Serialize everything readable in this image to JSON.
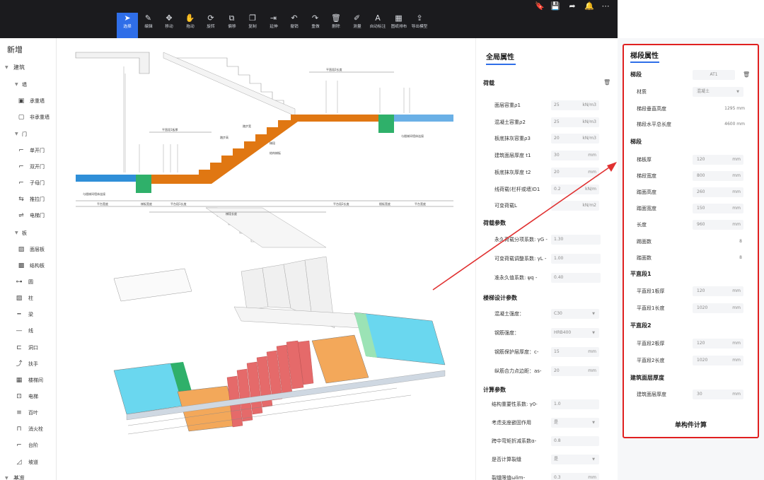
{
  "toolbar": {
    "tools": [
      {
        "label": "选择",
        "icon": "cursor-icon"
      },
      {
        "label": "编辑",
        "icon": "pencil-icon"
      },
      {
        "label": "移动",
        "icon": "move-icon"
      },
      {
        "label": "拖动",
        "icon": "hand-icon"
      },
      {
        "label": "旋转",
        "icon": "rotate-icon"
      },
      {
        "label": "偏移",
        "icon": "offset-icon"
      },
      {
        "label": "复制",
        "icon": "copy-icon"
      },
      {
        "label": "延伸",
        "icon": "extend-icon"
      },
      {
        "label": "撤销",
        "icon": "undo-icon"
      },
      {
        "label": "重做",
        "icon": "redo-icon"
      },
      {
        "label": "删除",
        "icon": "trash-icon"
      },
      {
        "label": "测量",
        "icon": "measure-icon"
      },
      {
        "label": "自动标注",
        "icon": "auto-label-icon"
      },
      {
        "label": "图纸排布",
        "icon": "layout-icon"
      },
      {
        "label": "导出模型",
        "icon": "export-icon"
      }
    ],
    "top_icons": [
      "bookmark-icon",
      "save-icon",
      "share-icon",
      "alert-icon",
      "more-icon"
    ]
  },
  "sidebar": {
    "title": "新增",
    "categories": [
      {
        "label": "建筑"
      },
      {
        "label": "墙"
      },
      {
        "label": "门"
      },
      {
        "label": "板"
      },
      {
        "label": "基准"
      }
    ],
    "items": [
      {
        "label": "承重墙"
      },
      {
        "label": "非承重墙"
      },
      {
        "label": "单开门"
      },
      {
        "label": "双开门"
      },
      {
        "label": "子母门"
      },
      {
        "label": "推拉门"
      },
      {
        "label": "电梯门"
      },
      {
        "label": "面层板"
      },
      {
        "label": "结构板"
      },
      {
        "label": "圆"
      },
      {
        "label": "柱"
      },
      {
        "label": "梁"
      },
      {
        "label": "线"
      },
      {
        "label": "洞口"
      },
      {
        "label": "扶手"
      },
      {
        "label": "楼梯间"
      },
      {
        "label": "电梯"
      },
      {
        "label": "百叶"
      },
      {
        "label": "消火栓"
      },
      {
        "label": "台阶"
      },
      {
        "label": "坡道"
      }
    ]
  },
  "global_panel": {
    "title": "全局属性",
    "sections": {
      "load": "荷载",
      "load_params": "荷载参数",
      "design_params": "楼梯设计参数",
      "calc_params": "计算参数"
    },
    "load_rows": [
      {
        "label": "面层容重ρ1",
        "value": "25",
        "unit": "kN/m3"
      },
      {
        "label": "混凝土容重ρ2",
        "value": "25",
        "unit": "kN/m3"
      },
      {
        "label": "板底抹灰容重ρ3",
        "value": "20",
        "unit": "kN/m3"
      },
      {
        "label": "建筑面层厚度 t1",
        "value": "30",
        "unit": "mm"
      },
      {
        "label": "板底抹灰厚度 t2",
        "value": "20",
        "unit": "mm"
      },
      {
        "label": "线荷载(栏杆或墙)D1",
        "value": "0.2",
        "unit": "kN/m"
      },
      {
        "label": "可变荷载L",
        "value": "",
        "unit": "kN/m2"
      }
    ],
    "param_rows": [
      {
        "label": "永久荷载分项系数: γG -",
        "value": "1.30"
      },
      {
        "label": "可变荷载调整系数: γL -",
        "value": "1.00"
      },
      {
        "label": "准永久值系数: ψq -",
        "value": "0.40"
      }
    ],
    "design_rows": [
      {
        "label": "混凝土强度：",
        "value": "C30"
      },
      {
        "label": "钢筋强度：",
        "value": "HRB400"
      },
      {
        "label": "钢筋保护层厚度：c-",
        "value": "15",
        "unit": "mm"
      },
      {
        "label": "纵筋合力点边距：as-",
        "value": "20",
        "unit": "mm"
      }
    ],
    "calc_rows": [
      {
        "label": "结构重要性系数: γ0-",
        "value": "1.0"
      },
      {
        "label": "考虑支座嵌固作用",
        "value": "是"
      },
      {
        "label": "跨中弯矩折减系数α-",
        "value": "0.8"
      },
      {
        "label": "是否计算裂缝",
        "value": "是"
      },
      {
        "label": "裂缝限值ωlim-",
        "value": "0.3",
        "unit": "mm"
      }
    ]
  },
  "segment_panel": {
    "title": "梯段属性",
    "segment_label": "梯段",
    "segment_value": "AT1",
    "material_label": "材质",
    "material_value": "混凝土",
    "height_label": "梯段垂直高度",
    "height_value": "1295 mm",
    "length_label": "梯段水平总长度",
    "length_value": "4600 mm",
    "sections": {
      "flight": "梯段",
      "platform1": "平直段1",
      "platform2": "平直段2",
      "finish": "建筑面层厚度"
    },
    "flight_rows": [
      {
        "label": "梯板厚",
        "value": "120",
        "unit": "mm"
      },
      {
        "label": "梯段宽度",
        "value": "800",
        "unit": "mm"
      },
      {
        "label": "踏面高度",
        "value": "260",
        "unit": "mm"
      },
      {
        "label": "踏面宽度",
        "value": "150",
        "unit": "mm"
      },
      {
        "label": "长度",
        "value": "960",
        "unit": "mm"
      }
    ],
    "count_rows": [
      {
        "label": "踢面数",
        "value": "8"
      },
      {
        "label": "踏面数",
        "value": "8"
      }
    ],
    "p1_rows": [
      {
        "label": "平直段1板厚",
        "value": "120",
        "unit": "mm"
      },
      {
        "label": "平直段1长度",
        "value": "1020",
        "unit": "mm"
      }
    ],
    "p2_rows": [
      {
        "label": "平直段2板厚",
        "value": "120",
        "unit": "mm"
      },
      {
        "label": "平直段2长度",
        "value": "1020",
        "unit": "mm"
      }
    ],
    "finish_rows": [
      {
        "label": "建筑面层厚度",
        "value": "30",
        "unit": "mm"
      }
    ],
    "button": "单构件计算"
  },
  "drawing": {
    "section_labels": [
      "平台宽度",
      "梯板宽度",
      "平台段1长度",
      "梯段长度",
      "平台段2长度",
      "楼板宽度",
      "平台宽度",
      "平直段2长度",
      "平直段1板厚",
      "结构梯板",
      "踏步高",
      "踏步宽",
      "梯段",
      "与楼梯间墙体连接"
    ],
    "colors": {
      "slab": "#2f8fd8",
      "stair": "#e07712",
      "green": "#2fb06a",
      "cyan": "#6ad7ef",
      "orange3d": "#f3a85a",
      "red3d": "#e56a6a",
      "arrow": "#e03030"
    }
  }
}
